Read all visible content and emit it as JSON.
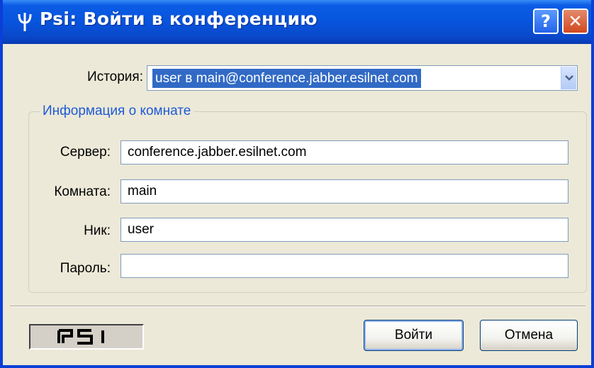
{
  "window": {
    "title": "Psi: Войти в конференцию",
    "help_label": "?",
    "close_label": "✕"
  },
  "history": {
    "label": "История:",
    "selected": "user в main@conference.jabber.esilnet.com"
  },
  "room_info": {
    "group_title": "Информация о комнате",
    "server_label": "Сервер:",
    "server_value": "conference.jabber.esilnet.com",
    "room_label": "Комната:",
    "room_value": "main",
    "nick_label": "Ник:",
    "nick_value": "user",
    "password_label": "Пароль:",
    "password_value": ""
  },
  "footer": {
    "logo_text": "PSI",
    "login_label": "Войти",
    "cancel_label": "Отмена"
  },
  "colors": {
    "titlebar": "#0854dd",
    "group_title": "#1e5ad6",
    "selection": "#316ac5",
    "dialog_bg": "#ece9d8"
  }
}
